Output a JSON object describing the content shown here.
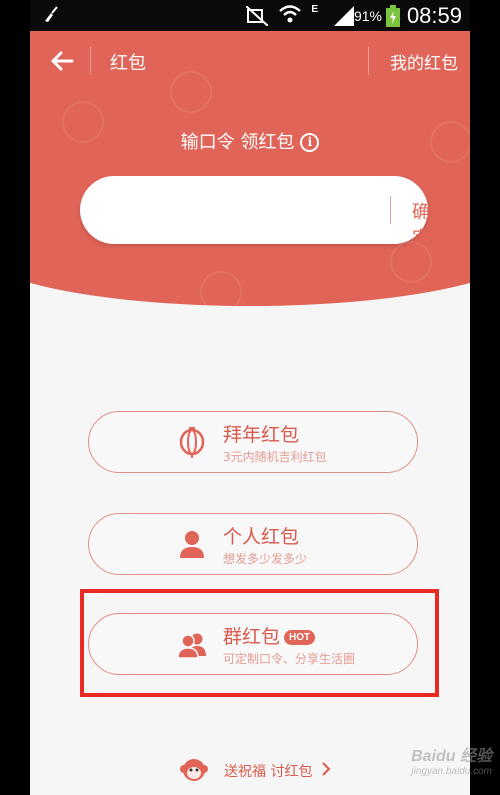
{
  "status_bar": {
    "lte_label": "E",
    "battery_percent": "91%",
    "time": "08:59"
  },
  "topbar": {
    "title": "红包",
    "right_link": "我的红包"
  },
  "command": {
    "title": "输口令 领红包",
    "input_value": "",
    "confirm_label": "确定"
  },
  "options": [
    {
      "name": "拜年红包",
      "sub": "3元内随机吉利红包",
      "icon": "lantern-icon"
    },
    {
      "name": "个人红包",
      "sub": "想发多少发多少",
      "icon": "person-icon"
    },
    {
      "name": "群红包",
      "badge": "HOT",
      "sub": "可定制口令、分享生活圈",
      "icon": "group-icon"
    }
  ],
  "footer": {
    "text": "送祝福 讨红包"
  },
  "watermark": {
    "brand": "Baidu 经验",
    "url": "jingyan.baidu.com"
  },
  "colors": {
    "brand_red": "#e06457",
    "highlight_box": "#e82a22"
  }
}
